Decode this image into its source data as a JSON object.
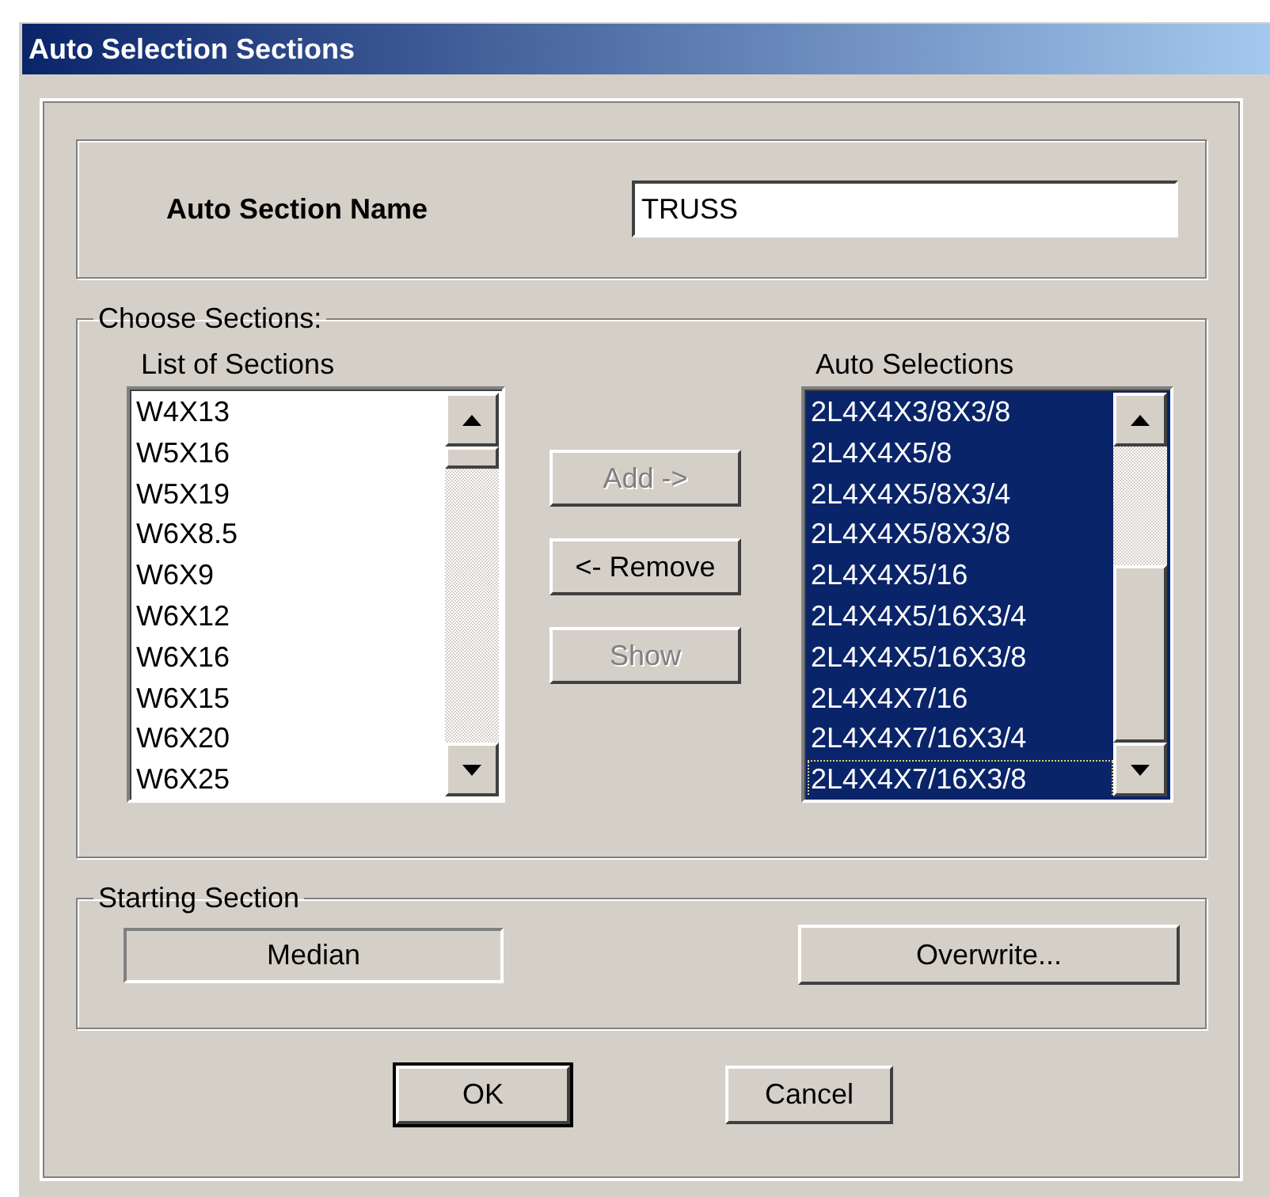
{
  "window": {
    "title": "Auto Selection Sections"
  },
  "auto_section_name": {
    "label": "Auto Section Name",
    "value": "TRUSS"
  },
  "choose_sections": {
    "title": "Choose Sections:",
    "list_of_sections": {
      "label": "List of Sections",
      "items": [
        {
          "text": "W4X13",
          "selected": false
        },
        {
          "text": "W5X16",
          "selected": false
        },
        {
          "text": "W5X19",
          "selected": false
        },
        {
          "text": "W6X8.5",
          "selected": false
        },
        {
          "text": "W6X9",
          "selected": false
        },
        {
          "text": "W6X12",
          "selected": false
        },
        {
          "text": "W6X16",
          "selected": false
        },
        {
          "text": "W6X15",
          "selected": false
        },
        {
          "text": "W6X20",
          "selected": false
        },
        {
          "text": "W6X25",
          "selected": false
        }
      ]
    },
    "buttons": [
      {
        "label": "Add ->",
        "disabled": true
      },
      {
        "label": "<- Remove",
        "disabled": false
      },
      {
        "label": "Show",
        "disabled": true
      }
    ],
    "auto_selections": {
      "label": "Auto Selections",
      "items": [
        {
          "text": "2L4X4X3/8X3/8",
          "selected": true,
          "focused": false
        },
        {
          "text": "2L4X4X5/8",
          "selected": true,
          "focused": false
        },
        {
          "text": "2L4X4X5/8X3/4",
          "selected": true,
          "focused": false
        },
        {
          "text": "2L4X4X5/8X3/8",
          "selected": true,
          "focused": false
        },
        {
          "text": "2L4X4X5/16",
          "selected": true,
          "focused": false
        },
        {
          "text": "2L4X4X5/16X3/4",
          "selected": true,
          "focused": false
        },
        {
          "text": "2L4X4X5/16X3/8",
          "selected": true,
          "focused": false
        },
        {
          "text": "2L4X4X7/16",
          "selected": true,
          "focused": false
        },
        {
          "text": "2L4X4X7/16X3/4",
          "selected": true,
          "focused": false
        },
        {
          "text": "2L4X4X7/16X3/8",
          "selected": true,
          "focused": true
        }
      ]
    }
  },
  "starting_section": {
    "title": "Starting Section",
    "value": "Median",
    "button": "Overwrite..."
  },
  "buttons": [
    {
      "label": "OK",
      "default": true
    },
    {
      "label": "Cancel",
      "default": false
    }
  ]
}
